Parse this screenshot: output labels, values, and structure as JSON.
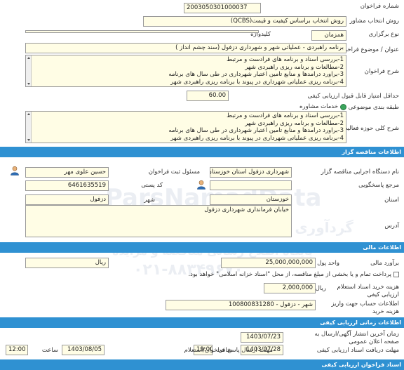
{
  "header": {
    "number_label": "شماره فراخوان",
    "number_value": "2003050301000037",
    "method_label": "روش انتخاب مشاور",
    "method_value": "روش انتخاب براساس کیفیت و قیمت(QCBS)",
    "type_label": "نوع برگزاری",
    "type_value": "همزمان",
    "keyword_label": "کلیدواژه",
    "keyword_value": "",
    "subject_label": "عنوان / موضوع فراخوان",
    "subject_value": "برنامه راهبردی - عملیاتی شهر و شهرداری دزفول (سند چشم انداز )",
    "description_label": "شرح فراخوان",
    "description_lines": [
      "1-بررسی اسناد و برنامه های فرادست و مرتبط",
      "2-مطالعات و برنامه ریزی راهبردی شهر",
      "3-برآورد درآمدها و منابع تامین اعتبار شهرداری در طی سال های برنامه",
      "4-برنامه ریزی عملیاتی شهرداری در پیوند با برنامه ریزی راهبردی شهر"
    ],
    "min_score_label": "حداقل امتیاز قابل قبول ارزیابی کیفی",
    "min_score_value": "60.00",
    "category_label": "طبقه بندی موضوعی",
    "category_value": "خدمات مشاوره",
    "activity_label": "شرح کلی حوزه فعالیت",
    "activity_lines": [
      "1-بررسی اسناد و برنامه های فرادست و مرتبط",
      "2-مطالعات و برنامه ریزی راهبردی شهر",
      "3-برآورد درآمدها و منابع تامین اعتبار شهرداری در طی سال های برنامه",
      "4-برنامه ریزی عملیاتی شهرداری در پیوند با برنامه ریزی راهبردی شهر"
    ]
  },
  "organizer": {
    "section_title": "اطلاعات مناقصه گزار",
    "org_label": "نام دستگاه اجرایی مناقصه گزار",
    "org_value": "شهرداری دزفول استان خوزستان",
    "registrar_label": "مسئول ثبت فراخوان",
    "registrar_value": "حسین علوی مهر",
    "reply_label": "مرجع پاسخگویی",
    "reply_value": "",
    "postal_label": "کد پستی",
    "postal_value": "6461635519",
    "province_label": "استان",
    "province_value": "خوزستان",
    "city_label": "شهر",
    "city_value": "دزفول",
    "address_label": "آدرس",
    "address_value": "خیابان فرمانداری شهرداری دزفول"
  },
  "financial": {
    "section_title": "اطلاعات مالی",
    "estimate_label": "برآورد مالی",
    "estimate_value": "25,000,000,000",
    "currency_label": "واحد پول",
    "currency_value": "ریال",
    "payment_label": "پرداخت تمام و یا بخشی از مبلغ مناقصه، از محل \"اسناد خزانه اسلامی\" خواهد بود.",
    "doc_fee_label_1": "هزینه خرید اسناد استعلام",
    "doc_fee_label_2": "ارزیابی کیفی",
    "doc_fee_value": "2,000,000",
    "doc_fee_unit": "ریال",
    "account_label_1": "اطلاعات حساب جهت واریز",
    "account_label_2": "هزینه خرید",
    "account_value": "شهر - دزفول - 100800831280"
  },
  "timing": {
    "section_title": "اطلاعات زمانی ارزیابی کیفی",
    "publish_label_1": "زمان آخرین انتشار آگهی/ارسال به",
    "publish_label_2": "صفحه اعلان عمومی",
    "publish_value": "1403/07/23",
    "receive_label": "مهلت دریافت اسناد ارزیابی کیفی",
    "receive_value": "1403/07/28",
    "receive_time_label": "ساعت",
    "receive_time_value": "19:00",
    "send_label": "مهلت ارسال پاسخ فراخوان/استعلام",
    "send_value": "1403/08/05",
    "send_time_label": "ساعت",
    "send_time_value": "12:00"
  },
  "footer": {
    "section_title": "اسناد فراخوان ارزیابی کیفی"
  },
  "watermark": {
    "brand": "ParsNamadData",
    "line1": "گردآوری اطلاعات پارس نماد داده ها",
    "line2": "پایگاه اطلاع رسانی مناقصه و مزایده",
    "phone": "۰۲۱-۸۸۳۴۹۶۷۰"
  },
  "colors": {
    "section_bar": "#2f91d2",
    "field_bg": "#fffde5",
    "field_border": "#9a9a9a"
  },
  "icons": {
    "registrar": "person-icon",
    "reply": "person-icon",
    "payment_checkbox": "checkbox-icon"
  }
}
